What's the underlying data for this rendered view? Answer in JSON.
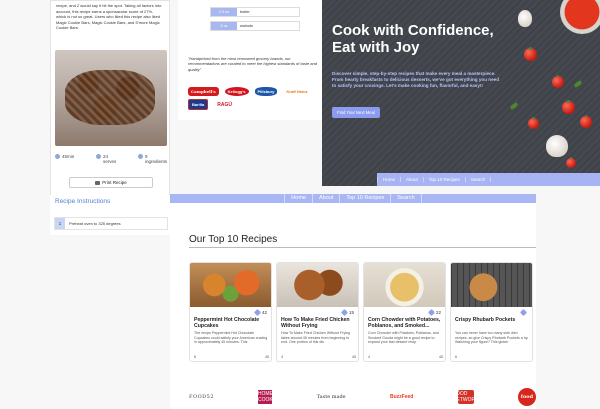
{
  "recipe_detail": {
    "description": "recipe, and 2 would say it hit the spot. Taking all factors into account, this recipe earns a sponsacular score of 27%, which is not so great. Users who liked this recipe also liked Magic Cookie Bars, Magic Cookie Bars, and S'more Magic Cookie Bars.",
    "stats": [
      {
        "icon": "clock-icon",
        "value": "45min"
      },
      {
        "icon": "people-icon",
        "value": "24",
        "unit": "serves"
      },
      {
        "icon": "ingredients-icon",
        "value": "9",
        "unit": "ingredients"
      }
    ],
    "print_label": "Print Recipe"
  },
  "instructions": {
    "title": "Recipe Instructions",
    "steps": [
      {
        "number": "1",
        "text": "Preheat oven to 325 degrees"
      }
    ]
  },
  "subscribe": {
    "fields": [
      {
        "label": "1.0 oz",
        "value": "butter"
      },
      {
        "label": "9 oz",
        "value": "walnuts"
      }
    ],
    "quote": "\"Handpicked from the most renowned grocery brands, our recommendations are curated to meet the highest standards of taste and quality\"",
    "logos": [
      "Campbell's",
      "Kellogg's",
      "Pillsbury",
      "Kraft Heinz",
      "Barilla",
      "RAGÚ"
    ]
  },
  "hero": {
    "title": "Cook with Confidence, Eat with Joy",
    "subtitle": "Discover simple, step-by-step recipes that make every meal a masterpiece. From hearty breakfasts to delicious desserts, we've got everything you need to satisfy your cravings. Let's make cooking fun, flavorful, and easy!!",
    "cta": "Find Your Next Meal",
    "nav": [
      "Home",
      "About",
      "Top 10 Recipes",
      "Search"
    ]
  },
  "top10": {
    "nav": [
      "Home",
      "About",
      "Top 10 Recipes",
      "Search"
    ],
    "title": "Our Top 10 Recipes",
    "cards": [
      {
        "title": "Peppermint Hot Chocolate Cupcakes",
        "likes": "42",
        "desc": "The recipe Peppermint Hot Chocolate Cupcakes could satisfy your American craving in approximately 45 minutes. This",
        "servings": "6",
        "time": "45"
      },
      {
        "title": "How To Make Fried Chicken Without Frying",
        "likes": "15",
        "desc": "How To Make Fried Chicken Without Frying takes around 45 minutes from beginning to end. One portion of this dis",
        "servings": "4",
        "time": "45"
      },
      {
        "title": "Corn Chowder with Potatoes, Poblanos, and Smoked...",
        "likes": "22",
        "desc": "Corn Chowder with Potatoes, Poblanos, and Smoked Gouda might be a good recipe to expand your fast dessert recip",
        "servings": "4",
        "time": "45"
      },
      {
        "title": "Crispy Rhubarb Pockets",
        "likes": "",
        "desc": "You can never have too many side dish recipes, so give Crispy Rhubarb Pockets a try. Watching your figure? This gluten",
        "servings": "6",
        "time": ""
      }
    ],
    "brands": [
      "FOOD52",
      "HOME COOK",
      "Taste made",
      "BuzzFeed",
      "FOOD NETWORK",
      "food"
    ]
  }
}
